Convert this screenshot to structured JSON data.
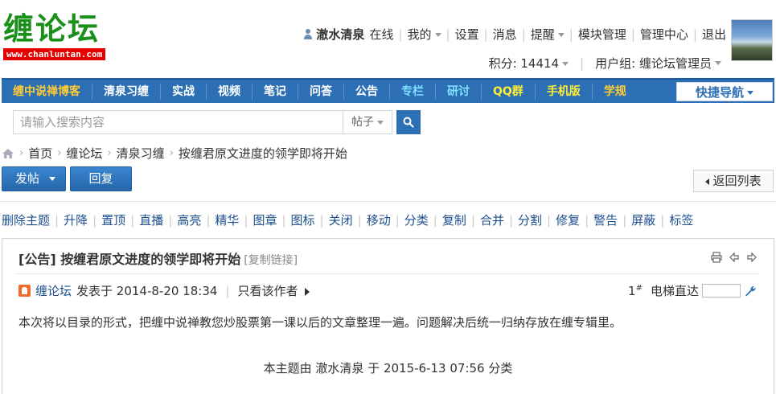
{
  "header": {
    "logo_text": "缠论坛",
    "logo_url": "www.chanluntan.com",
    "username": "澈水清泉",
    "online_status": "在线",
    "links": [
      "我的",
      "设置",
      "消息",
      "提醒",
      "模块管理",
      "管理中心",
      "退出"
    ],
    "points_label": "积分: 14414",
    "usergroup_label": "用户组: 缠论坛管理员"
  },
  "nav": {
    "items": [
      {
        "label": "缠中说禅博客",
        "color": "#ffcc33"
      },
      {
        "label": "清泉习缠",
        "color": "#ffffff"
      },
      {
        "label": "实战",
        "color": "#ffffff"
      },
      {
        "label": "视频",
        "color": "#ffffff"
      },
      {
        "label": "笔记",
        "color": "#ffffff"
      },
      {
        "label": "问答",
        "color": "#ffffff"
      },
      {
        "label": "公告",
        "color": "#ffffff"
      },
      {
        "label": "专栏",
        "color": "#7fe0ff"
      },
      {
        "label": "研讨",
        "color": "#7fe0ff"
      },
      {
        "label": "QQ群",
        "color": "#ffee33"
      },
      {
        "label": "手机版",
        "color": "#ffee33"
      },
      {
        "label": "学规",
        "color": "#ffcc33"
      }
    ],
    "quick_nav": "快捷导航"
  },
  "search": {
    "placeholder": "请输入搜索内容",
    "type": "帖子"
  },
  "breadcrumb": [
    "首页",
    "缠论坛",
    "清泉习缠",
    "按缠君原文进度的领学即将开始"
  ],
  "actions": {
    "post": "发帖",
    "reply": "回复",
    "back": "返回列表"
  },
  "moderation": [
    "删除主题",
    "升降",
    "置顶",
    "直播",
    "高亮",
    "精华",
    "图章",
    "图标",
    "关闭",
    "移动",
    "分类",
    "复制",
    "合并",
    "分割",
    "修复",
    "警告",
    "屏蔽",
    "标签"
  ],
  "post": {
    "title": "[公告] 按缠君原文进度的领学即将开始",
    "copy_link": "[复制链接]",
    "author": "缠论坛",
    "posted_at": "发表于 2014-8-20 18:34",
    "only_author": "只看该作者",
    "floor": "1",
    "floor_mark": "#",
    "elevator": "电梯直达",
    "content": "本次将以目录的形式，把缠中说禅教您炒股票第一课以后的文章整理一遍。问题解决后统一归纳存放在缠专辑里。",
    "footer": "本主题由 澈水清泉 于 2015-6-13 07:56 分类"
  },
  "colors": {
    "nav_bg": "#2d6fb5",
    "logo_green": "#1a8f1a",
    "link_blue": "#1d4f8f"
  }
}
